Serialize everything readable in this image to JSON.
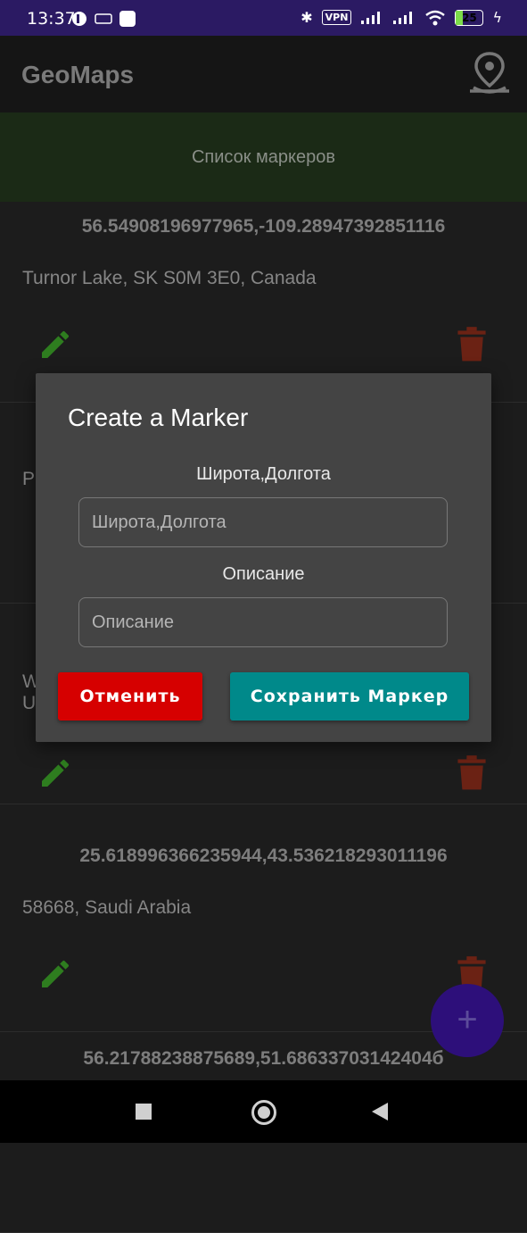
{
  "status_bar": {
    "time": "13:37",
    "vpn": "VPN",
    "battery": "25"
  },
  "app_bar": {
    "title": "GeoMaps"
  },
  "section_header": "Список маркеров",
  "markers": [
    {
      "coords": "56.54908196977965,-109.28947392851116",
      "address": "Turnor Lake, SK S0M 3E0, Canada"
    },
    {
      "coords": "",
      "address": "P"
    },
    {
      "coords": "",
      "address": "W\nU"
    },
    {
      "coords": "25.618996366235944,43.536218293011196",
      "address": "58668, Saudi Arabia"
    },
    {
      "coords": "56.21788238875689,51.68633703142404б",
      "address": ""
    }
  ],
  "fab_label": "+",
  "dialog": {
    "title": "Create a Marker",
    "coords_label": "Широта,Долгота",
    "coords_placeholder": "Широта,Долгота",
    "description_label": "Описание",
    "description_placeholder": "Описание",
    "cancel_label": "Отменить",
    "save_label": "Сохранить Маркер"
  },
  "colors": {
    "edit_icon": "#2e7d1f",
    "delete_icon": "#6b2214",
    "cancel_button": "#d60000",
    "save_button": "#00898a",
    "fab": "#2d0f7a"
  }
}
